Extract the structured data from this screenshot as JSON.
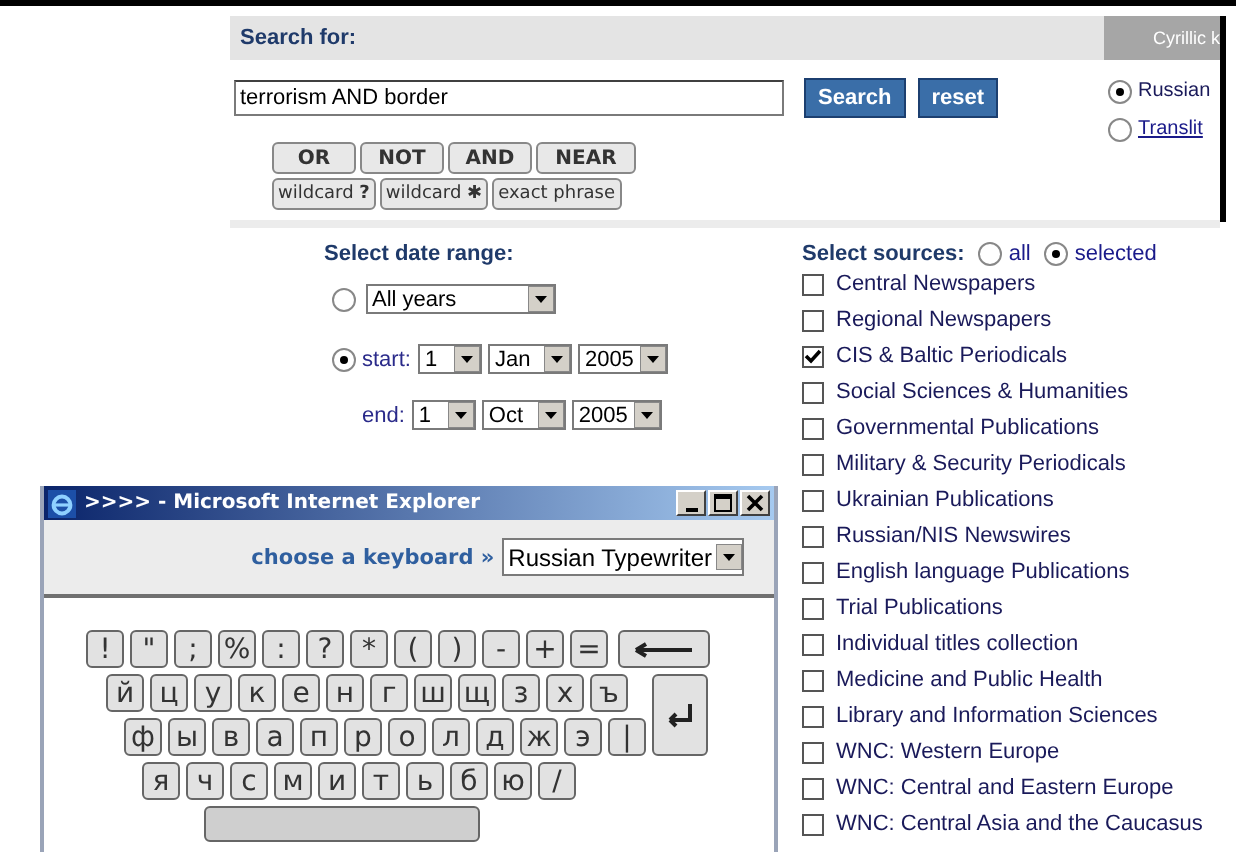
{
  "search_header": {
    "title": "Search for:"
  },
  "side_panel": {
    "title": "Cyrillic k",
    "options": [
      {
        "label": "Russian",
        "selected": true,
        "kind": "text"
      },
      {
        "label": "Translit",
        "selected": false,
        "kind": "link"
      }
    ]
  },
  "search": {
    "value": "terrorism AND border",
    "buttons": [
      "Search",
      "reset"
    ]
  },
  "operators": [
    [
      "OR",
      "NOT",
      "AND",
      "NEAR"
    ],
    [
      "wildcard **?**",
      "wildcard **✱**",
      "exact phrase"
    ]
  ],
  "date_range": {
    "title": "Select date range:",
    "all_option": {
      "selected": false,
      "value": "All years"
    },
    "start": {
      "selected": true,
      "label": "start:",
      "day": "1",
      "month": "Jan",
      "year": "2005"
    },
    "end": {
      "label": "end:",
      "day": "1",
      "month": "Oct",
      "year": "2005"
    }
  },
  "sources": {
    "title": "Select sources:",
    "scope": [
      {
        "label": "all",
        "selected": false
      },
      {
        "label": "selected",
        "selected": true
      }
    ],
    "items": [
      {
        "label": "Central Newspapers",
        "checked": false
      },
      {
        "label": "Regional Newspapers",
        "checked": false
      },
      {
        "label": "CIS & Baltic Periodicals",
        "checked": true
      },
      {
        "label": "Social Sciences & Humanities",
        "checked": false
      },
      {
        "label": "Governmental Publications",
        "checked": false
      },
      {
        "label": "Military & Security Periodicals",
        "checked": false
      },
      {
        "label": "Ukrainian Publications",
        "checked": false
      },
      {
        "label": "Russian/NIS Newswires",
        "checked": false
      },
      {
        "label": "English language Publications",
        "checked": false
      },
      {
        "label": "Trial Publications",
        "checked": false
      },
      {
        "label": "Individual titles collection",
        "checked": false
      },
      {
        "label": "Medicine and Public Health",
        "checked": false
      },
      {
        "label": "Library and Information Sciences",
        "checked": false
      },
      {
        "label": "WNC: Western Europe",
        "checked": false
      },
      {
        "label": "WNC: Central and Eastern Europe",
        "checked": false
      },
      {
        "label": "WNC: Central Asia and the Caucasus",
        "checked": false
      }
    ]
  },
  "popup": {
    "title": ">>>> - Microsoft Internet Explorer",
    "keyboard_label": "choose a keyboard »",
    "keyboard": "Russian Typewriter",
    "rows": [
      [
        "!",
        "\"",
        ";",
        "%",
        ":",
        "?",
        "*",
        "(",
        ")",
        "-",
        "+",
        "="
      ],
      [
        "й",
        "ц",
        "у",
        "к",
        "е",
        "н",
        "г",
        "ш",
        "щ",
        "з",
        "х",
        "ъ"
      ],
      [
        "ф",
        "ы",
        "в",
        "а",
        "п",
        "р",
        "о",
        "л",
        "д",
        "ж",
        "э",
        "|"
      ],
      [
        "я",
        "ч",
        "с",
        "м",
        "и",
        "т",
        "ь",
        "б",
        "ю",
        "/"
      ]
    ]
  }
}
